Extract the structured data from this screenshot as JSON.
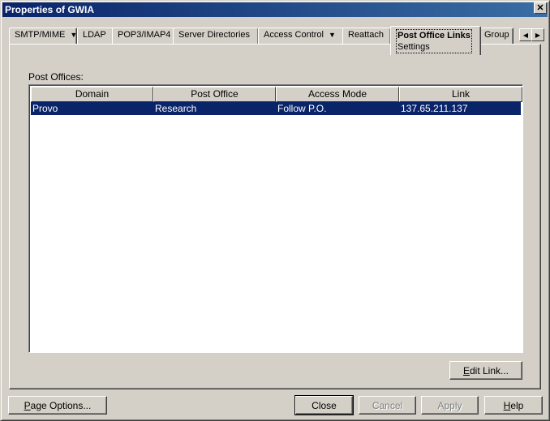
{
  "window": {
    "title": "Properties of GWIA",
    "close_glyph": "✕"
  },
  "tabs": [
    {
      "label": "SMTP/MIME",
      "has_menu": true
    },
    {
      "label": "LDAP"
    },
    {
      "label": "POP3/IMAP4"
    },
    {
      "label": "Server Directories"
    },
    {
      "label": "Access Control",
      "has_menu": true
    },
    {
      "label": "Reattach"
    },
    {
      "label": "Post Office Links",
      "sublabel": "Settings",
      "active": true
    },
    {
      "label": "Group"
    }
  ],
  "tab_scroll": {
    "left_icon": "◀",
    "right_icon": "▶"
  },
  "menu_caret": "▼",
  "post_offices": {
    "label": "Post Offices:",
    "columns": [
      "Domain",
      "Post Office",
      "Access Mode",
      "Link"
    ],
    "rows": [
      {
        "domain": "Provo",
        "post_office": "Research",
        "access_mode": "Follow P.O.",
        "link": "137.65.211.137"
      }
    ]
  },
  "buttons": {
    "edit_link": {
      "mnemonic": "E",
      "rest": "dit Link..."
    },
    "page_options": {
      "mnemonic": "P",
      "rest": "age Options..."
    },
    "close": "Close",
    "cancel": "Cancel",
    "apply": "Apply",
    "help": {
      "mnemonic": "H",
      "rest": "elp"
    }
  },
  "colors": {
    "selection": "#0a246a",
    "titlebar": "#0a246a",
    "face": "#d4d0c8"
  }
}
